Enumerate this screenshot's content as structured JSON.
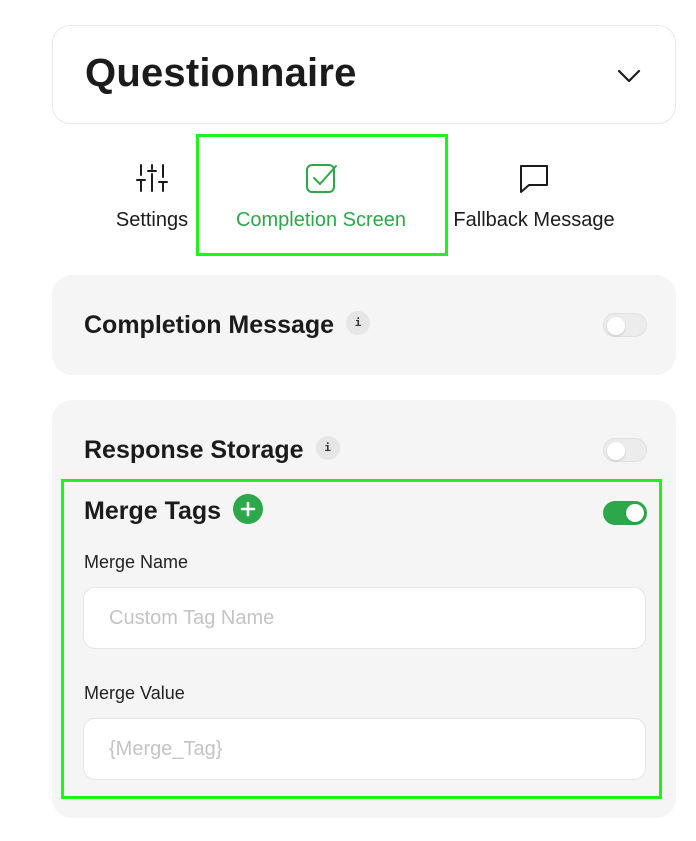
{
  "header": {
    "title": "Questionnaire",
    "chevron_icon": "chevron-down-icon"
  },
  "tabs": [
    {
      "label": "Settings",
      "icon": "sliders-icon",
      "active": false
    },
    {
      "label": "Completion Screen",
      "icon": "checkbox-icon",
      "active": true
    },
    {
      "label": "Fallback Message",
      "icon": "message-icon",
      "active": false
    }
  ],
  "completion_message": {
    "title": "Completion Message",
    "info": "i",
    "enabled": false
  },
  "response_storage": {
    "title": "Response Storage",
    "info": "i",
    "enabled": false,
    "merge_tags": {
      "title": "Merge Tags",
      "add_icon": "plus-circle-icon",
      "enabled": true,
      "merge_name": {
        "label": "Merge Name",
        "placeholder": "Custom Tag Name",
        "value": ""
      },
      "merge_value": {
        "label": "Merge Value",
        "placeholder": "{Merge_Tag}",
        "value": ""
      }
    }
  },
  "colors": {
    "accent": "#2ca84a",
    "highlight": "#1ef31e",
    "card_background": "#f5f5f5"
  }
}
